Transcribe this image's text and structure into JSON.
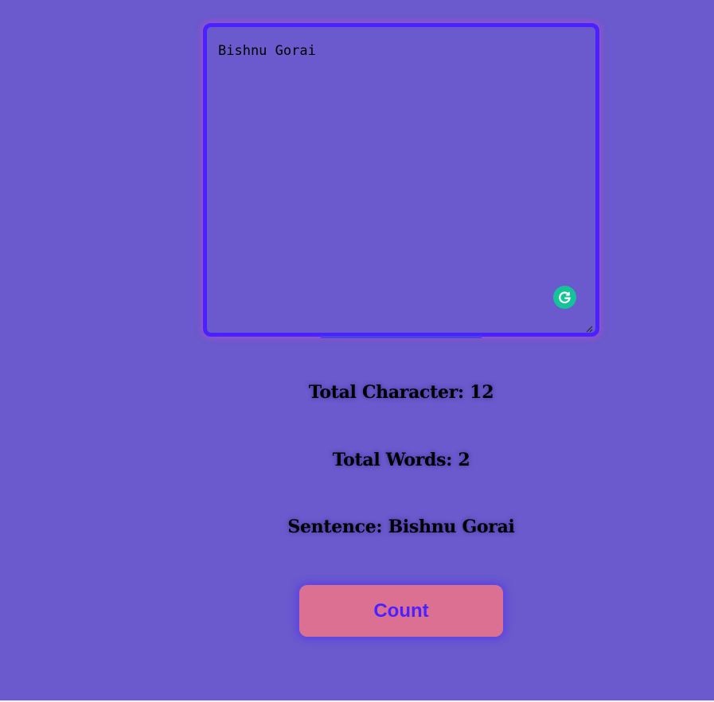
{
  "editor": {
    "value": "Bishnu Gorai"
  },
  "icons": {
    "grammarly": "grammarly-icon",
    "resize": "resize-grip-icon"
  },
  "stats": {
    "characters": "Total Character: 12",
    "words": "Total Words: 2",
    "sentence": "Sentence: Bishnu Gorai"
  },
  "actions": {
    "count_label": "Count"
  },
  "colors": {
    "background": "#6a5acd",
    "editor_border": "#4a22ff",
    "button_bg": "#db7093",
    "button_text": "#4a22ff",
    "grammarly": "#15c39a"
  }
}
